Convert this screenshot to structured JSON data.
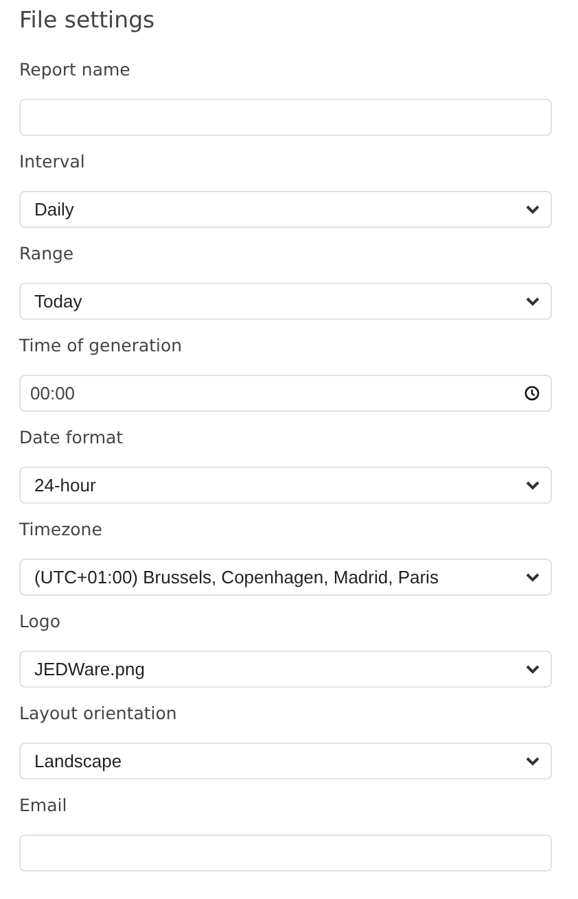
{
  "title": "File settings",
  "fields": [
    {
      "label": "Report name",
      "kind": "text"
    },
    {
      "label": "Interval",
      "kind": "select",
      "value": "Daily"
    },
    {
      "label": "Range",
      "kind": "select",
      "value": "Today"
    },
    {
      "label": "Time of generation",
      "kind": "time",
      "value": "00:00"
    },
    {
      "label": "Date format",
      "kind": "select",
      "value": "24-hour"
    },
    {
      "label": "Timezone",
      "kind": "select",
      "value": "(UTC+01:00) Brussels, Copenhagen, Madrid, Paris"
    },
    {
      "label": "Logo",
      "kind": "select",
      "value": "JEDWare.png"
    },
    {
      "label": "Layout orientation",
      "kind": "select",
      "value": "Landscape"
    },
    {
      "label": "Email",
      "kind": "text"
    }
  ]
}
